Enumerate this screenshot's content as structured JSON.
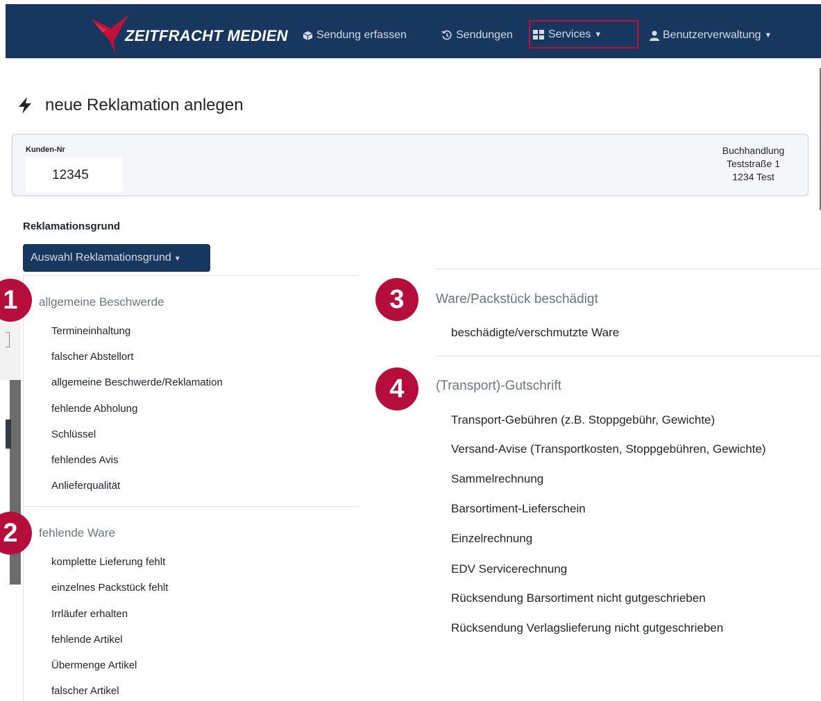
{
  "navbar": {
    "brand": "ZEITFRACHT MEDIEN",
    "items": [
      {
        "label": "Sendung erfassen",
        "icon": "box-icon"
      },
      {
        "label": "Sendungen",
        "icon": "history-icon"
      },
      {
        "label": "Services",
        "icon": "grid-icon"
      },
      {
        "label": "Benutzerverwaltung",
        "icon": "user-icon"
      }
    ],
    "colors": {
      "background": "#17375e",
      "highlight": "#c0103b"
    }
  },
  "page": {
    "title": "neue Reklamation anlegen",
    "icon": "bolt-icon"
  },
  "customer": {
    "label": "Kunden-Nr",
    "number": "12345",
    "address": {
      "line1": "Buchhandlung",
      "line2": "Teststraße 1",
      "line3": "1234 Test"
    }
  },
  "reason": {
    "label": "Reklamationsgrund",
    "button_label": "Auswahl Reklamationsgrund",
    "groups": [
      {
        "badge": "1",
        "header": "allgemeine Beschwerde",
        "items": [
          "Termineinhaltung",
          "falscher Abstellort",
          "allgemeine Beschwerde/Reklamation",
          "fehlende Abholung",
          "Schlüssel",
          "fehlendes Avis",
          "Anlieferqualität"
        ]
      },
      {
        "badge": "2",
        "header": "fehlende Ware",
        "items": [
          "komplette Lieferung fehlt",
          "einzelnes Packstück fehlt",
          "Irrläufer erhalten",
          "fehlende Artikel",
          "Übermenge Artikel",
          "falscher Artikel"
        ]
      },
      {
        "badge": "3",
        "header": "Ware/Packstück beschädigt",
        "items": [
          "beschädigte/verschmutzte Ware"
        ]
      },
      {
        "badge": "4",
        "header": "(Transport)-Gutschrift",
        "items": [
          "Transport-Gebühren (z.B. Stoppgebühr, Gewichte)",
          "Versand-Avise (Transportkosten, Stoppgebühren, Gewichte)",
          "Sammelrechnung",
          "Barsortiment-Lieferschein",
          "Einzelrechnung",
          "EDV Servicerechnung",
          "Rücksendung Barsortiment nicht gutgeschrieben",
          "Rücksendung Verlagslieferung nicht gutgeschrieben"
        ]
      }
    ],
    "badge_color": "#b50d3c"
  }
}
